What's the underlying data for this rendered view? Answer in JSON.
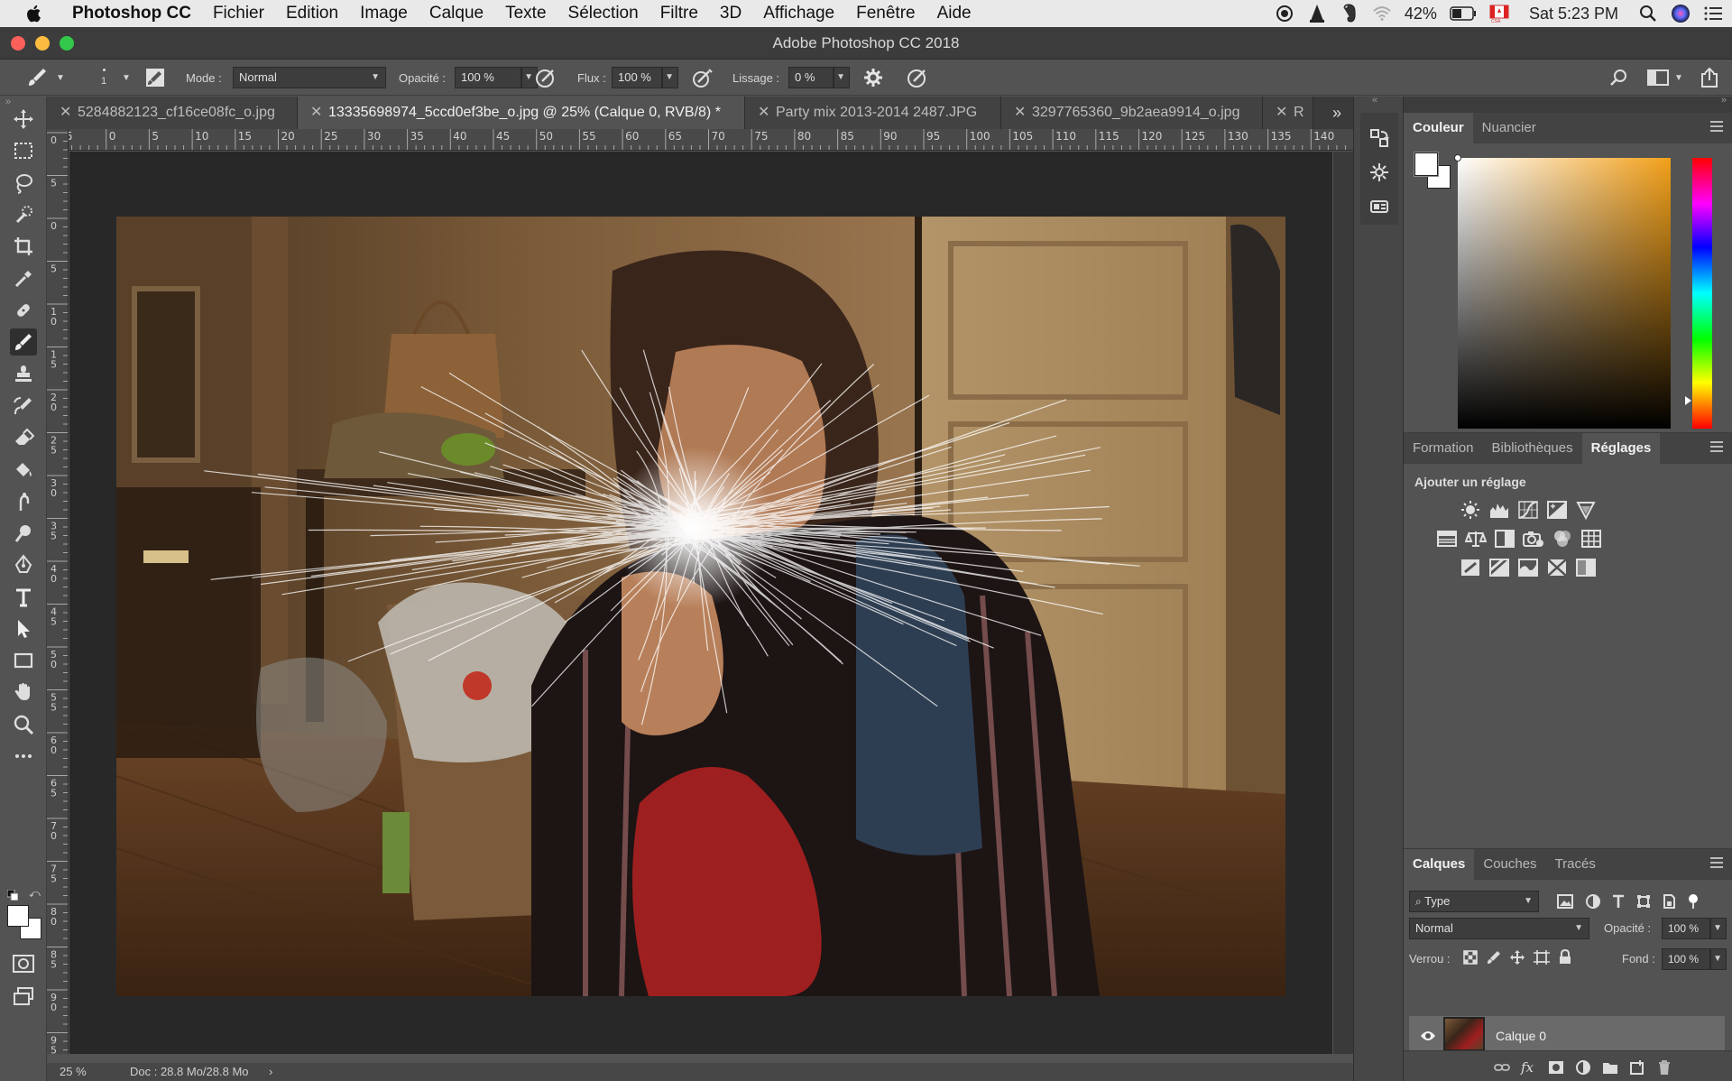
{
  "menubar": {
    "items": [
      "Photoshop CC",
      "Fichier",
      "Edition",
      "Image",
      "Calque",
      "Texte",
      "Sélection",
      "Filtre",
      "3D",
      "Affichage",
      "Fenêtre",
      "Aide"
    ],
    "battery": "42%",
    "clock": "Sat 5:23 PM",
    "status_icons": [
      "record-icon",
      "vlc-icon",
      "evernote-icon",
      "wifi-icon",
      "battery-icon",
      "flag-icon",
      "search-icon",
      "siri-icon",
      "list-icon"
    ]
  },
  "window": {
    "title": "Adobe Photoshop CC 2018",
    "lights": [
      "#fc605b",
      "#fdbc40",
      "#34c84a"
    ]
  },
  "options": {
    "brush_size": "1",
    "mode_label": "Mode :",
    "mode_value": "Normal",
    "opacity_label": "Opacité :",
    "opacity_value": "100 %",
    "flux_label": "Flux :",
    "flux_value": "100 %",
    "smoothing_label": "Lissage :",
    "smoothing_value": "0 %"
  },
  "tabs": [
    {
      "label": "5284882123_cf16ce08fc_o.jpg",
      "active": false
    },
    {
      "label": "13335698974_5ccd0ef3be_o.jpg @ 25% (Calque 0, RVB/8) *",
      "active": true
    },
    {
      "label": "Party mix 2013-2014 2487.JPG",
      "active": false
    },
    {
      "label": "3297765360_9b2aea9914_o.jpg",
      "active": false
    },
    {
      "label": "R",
      "active": false
    }
  ],
  "tabs_more": "»",
  "tools": [
    "move-tool-icon",
    "marquee-tool-icon",
    "lasso-tool-icon",
    "quick-selection-tool-icon",
    "crop-tool-icon",
    "eyedropper-tool-icon",
    "healing-brush-tool-icon",
    "brush-tool-icon",
    "clone-stamp-tool-icon",
    "history-brush-tool-icon",
    "eraser-tool-icon",
    "paint-bucket-tool-icon",
    "smudge-tool-icon",
    "dodge-tool-icon",
    "pen-tool-icon",
    "type-tool-icon",
    "path-selection-tool-icon",
    "rectangle-tool-icon",
    "hand-tool-icon",
    "zoom-tool-icon",
    "more-tools-icon"
  ],
  "ruler_top": [
    "5",
    "0",
    "5",
    "10",
    "15",
    "20",
    "25",
    "30",
    "35",
    "40",
    "45",
    "50",
    "55",
    "60",
    "65",
    "70",
    "75",
    "80",
    "85",
    "90",
    "95",
    "100",
    "105",
    "110",
    "115",
    "120",
    "125",
    "130",
    "135",
    "140"
  ],
  "ruler_left": [
    "0",
    "5",
    "0",
    "5",
    "10",
    "15",
    "20",
    "25",
    "30",
    "35",
    "40",
    "45",
    "50",
    "55",
    "60",
    "65",
    "70",
    "75",
    "80",
    "85",
    "90",
    "95"
  ],
  "status": {
    "zoom": "25 %",
    "doc": "Doc : 28.8 Mo/28.8 Mo",
    "arrow": "›"
  },
  "color_panel": {
    "tabs": [
      "Couleur",
      "Nuancier"
    ],
    "active_tab": "Couleur",
    "foreground": "#ffffff",
    "background": "#ffffff",
    "hue": "#f2a01a"
  },
  "adjustments_panel": {
    "tabs": [
      "Formation",
      "Bibliothèques",
      "Réglages"
    ],
    "active_tab": "Réglages",
    "heading": "Ajouter un réglage"
  },
  "layers_panel": {
    "tabs": [
      "Calques",
      "Couches",
      "Tracés"
    ],
    "active_tab": "Calques",
    "filter_value": "Type",
    "blend_mode": "Normal",
    "opacity_label": "Opacité :",
    "opacity_value": "100 %",
    "lock_label": "Verrou :",
    "fill_label": "Fond :",
    "fill_value": "100 %",
    "layers": [
      {
        "name": "Calque 0",
        "visible": true
      }
    ]
  }
}
